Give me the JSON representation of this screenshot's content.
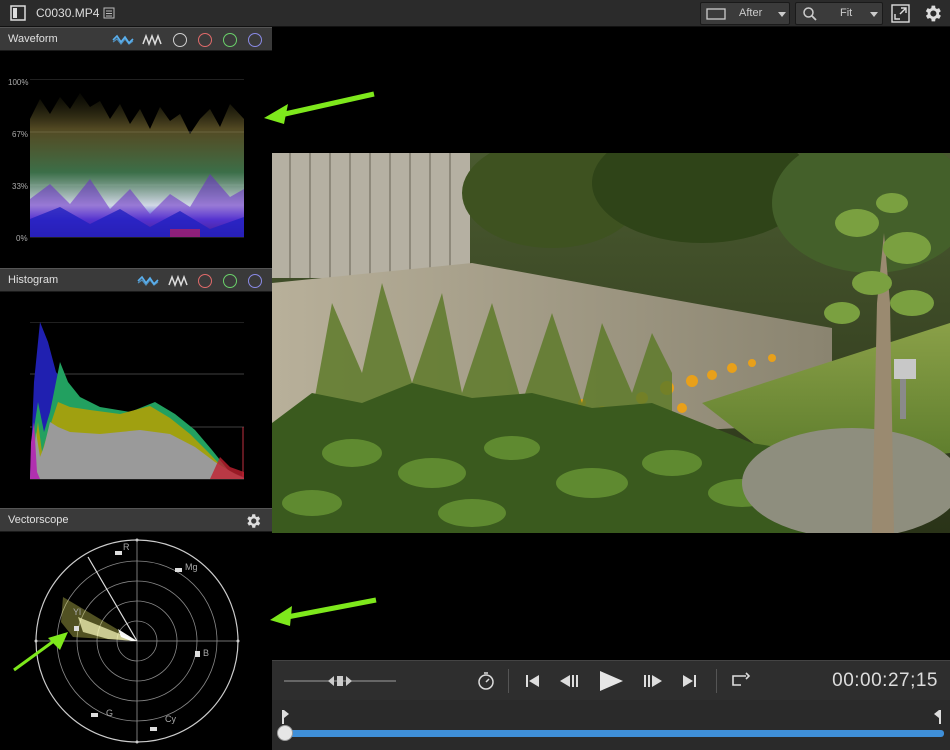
{
  "titlebar": {
    "filename": "C0030.MP4",
    "compare_mode": "After",
    "zoom_mode": "Fit"
  },
  "waveform": {
    "title": "Waveform",
    "levels": [
      "100%",
      "67%",
      "33%",
      "0%"
    ]
  },
  "histogram": {
    "title": "Histogram"
  },
  "vectorscope": {
    "title": "Vectorscope",
    "labels": {
      "r": "R",
      "mg": "Mg",
      "b": "B",
      "cy": "Cy",
      "g": "G",
      "yl": "Yl"
    }
  },
  "playback": {
    "timecode": "00:00:27;15",
    "position_fraction": 0.0
  },
  "colors": {
    "accent_blue": "#3f8fd8",
    "annotation_green": "#7ee81c",
    "circle_red": "#e06a6a",
    "circle_green": "#6ad06a",
    "circle_blue": "#8a8ae6"
  }
}
